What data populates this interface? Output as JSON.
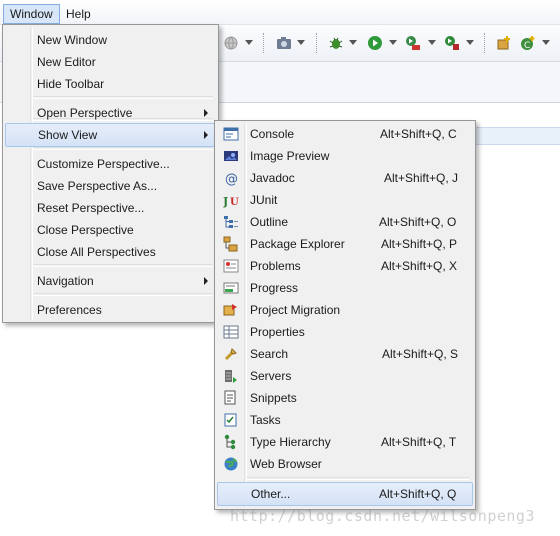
{
  "menubar": {
    "window": "Window",
    "help": "Help"
  },
  "window_menu": {
    "items": [
      {
        "label": "New Window"
      },
      {
        "label": "New Editor"
      },
      {
        "label": "Hide Toolbar"
      },
      {
        "label": "Open Perspective",
        "submenu": true
      },
      {
        "label": "Show View",
        "submenu": true,
        "highlighted": true
      },
      {
        "label": "Customize Perspective..."
      },
      {
        "label": "Save Perspective As..."
      },
      {
        "label": "Reset Perspective..."
      },
      {
        "label": "Close Perspective"
      },
      {
        "label": "Close All Perspectives"
      },
      {
        "label": "Navigation",
        "submenu": true
      },
      {
        "label": "Preferences"
      }
    ]
  },
  "show_view_menu": {
    "items": [
      {
        "label": "Console",
        "accel": "Alt+Shift+Q, C",
        "icon": "console-icon"
      },
      {
        "label": "Image Preview",
        "accel": "",
        "icon": "image-preview-icon"
      },
      {
        "label": "Javadoc",
        "accel": "Alt+Shift+Q, J",
        "icon": "javadoc-icon"
      },
      {
        "label": "JUnit",
        "accel": "",
        "icon": "junit-icon"
      },
      {
        "label": "Outline",
        "accel": "Alt+Shift+Q, O",
        "icon": "outline-icon"
      },
      {
        "label": "Package Explorer",
        "accel": "Alt+Shift+Q, P",
        "icon": "package-explorer-icon"
      },
      {
        "label": "Problems",
        "accel": "Alt+Shift+Q, X",
        "icon": "problems-icon"
      },
      {
        "label": "Progress",
        "accel": "",
        "icon": "progress-icon"
      },
      {
        "label": "Project Migration",
        "accel": "",
        "icon": "project-migration-icon"
      },
      {
        "label": "Properties",
        "accel": "",
        "icon": "properties-icon"
      },
      {
        "label": "Search",
        "accel": "Alt+Shift+Q, S",
        "icon": "search-icon"
      },
      {
        "label": "Servers",
        "accel": "",
        "icon": "servers-icon"
      },
      {
        "label": "Snippets",
        "accel": "",
        "icon": "snippets-icon"
      },
      {
        "label": "Tasks",
        "accel": "",
        "icon": "tasks-icon"
      },
      {
        "label": "Type Hierarchy",
        "accel": "Alt+Shift+Q, T",
        "icon": "type-hierarchy-icon"
      },
      {
        "label": "Web Browser",
        "accel": "",
        "icon": "web-browser-icon"
      },
      {
        "label": "Other...",
        "accel": "Alt+Shift+Q, Q",
        "icon": "",
        "highlighted": true
      }
    ]
  },
  "watermark": "http://blog.csdn.net/wilsonpeng3",
  "colors": {
    "menu_bg": "#f0f0f0",
    "highlight": "#d4e2f6",
    "highlight_border": "#a8c6ec"
  }
}
